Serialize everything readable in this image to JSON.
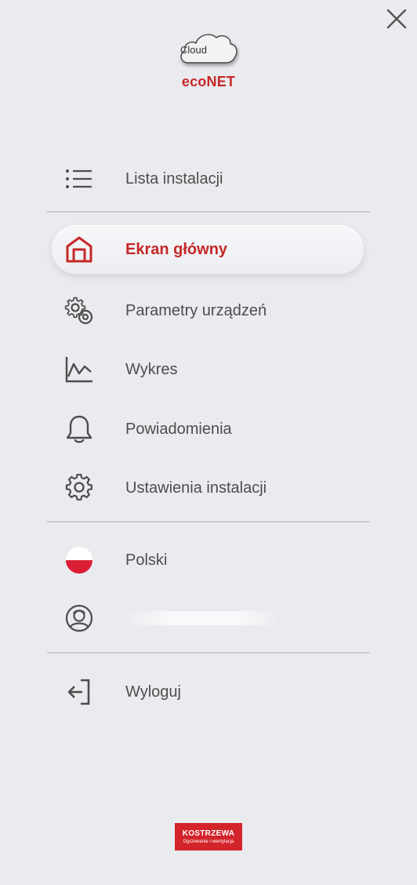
{
  "header": {
    "close_icon": "close-icon",
    "cloud_text": "Cloud",
    "brand": "ecoNET"
  },
  "colors": {
    "accent": "#c62828",
    "text": "#4d4d4d",
    "background": "#e9ebee",
    "divider": "#c9cbce"
  },
  "menu": {
    "installations": {
      "label": "Lista instalacji",
      "icon": "list-icon"
    },
    "home": {
      "label": "Ekran główny",
      "icon": "home-icon",
      "active": true
    },
    "device_params": {
      "label": "Parametry urządzeń",
      "icon": "gears-icon"
    },
    "chart": {
      "label": "Wykres",
      "icon": "chart-icon"
    },
    "notifications": {
      "label": "Powiadomienia",
      "icon": "bell-icon"
    },
    "install_settings": {
      "label": "Ustawienia instalacji",
      "icon": "gear-icon"
    },
    "language": {
      "label": "Polski",
      "icon": "poland-flag-icon"
    },
    "user": {
      "icon": "user-icon"
    },
    "logout": {
      "label": "Wyloguj",
      "icon": "logout-icon"
    }
  },
  "footer": {
    "brand": "KOSTRZEWA",
    "tagline": "Ogrzewanie i wentylacja"
  }
}
